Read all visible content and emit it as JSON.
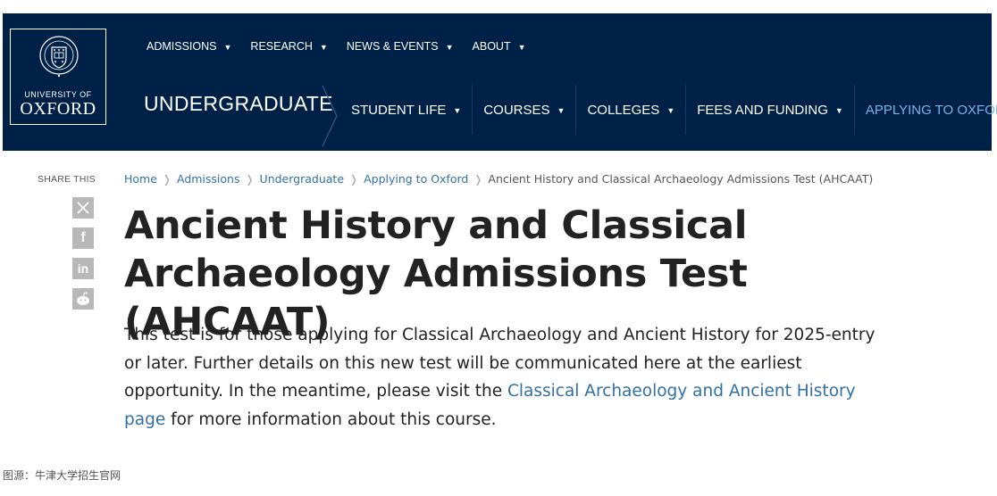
{
  "logo": {
    "line1": "UNIVERSITY OF",
    "line2": "OXFORD"
  },
  "top_nav": [
    {
      "label": "ADMISSIONS"
    },
    {
      "label": "RESEARCH"
    },
    {
      "label": "NEWS & EVENTS"
    },
    {
      "label": "ABOUT"
    }
  ],
  "section_title": "UNDERGRADUATE",
  "main_nav": [
    {
      "label": "STUDENT LIFE"
    },
    {
      "label": "COURSES"
    },
    {
      "label": "COLLEGES"
    },
    {
      "label": "FEES AND FUNDING"
    },
    {
      "label": "APPLYING TO OXFORD",
      "active": true
    }
  ],
  "share": {
    "label": "SHARE THIS",
    "icons": [
      "x-icon",
      "facebook-icon",
      "linkedin-icon",
      "reddit-icon"
    ]
  },
  "breadcrumb": [
    {
      "label": "Home"
    },
    {
      "label": "Admissions"
    },
    {
      "label": "Undergraduate"
    },
    {
      "label": "Applying to Oxford"
    },
    {
      "label": "Ancient History and Classical Archaeology Admissions Test (AHCAAT)"
    }
  ],
  "page": {
    "title": "Ancient History and Classical Archaeology Admissions Test (AHCAAT)",
    "body_before": "This test is for those applying for Classical Archaeology and Ancient History for 2025-entry or later. Further details on this new test will be communicated here at the earliest opportunity. In the meantime, please visit the ",
    "body_link": "Classical Archaeology and Ancient History page",
    "body_after": " for more information about this course."
  },
  "source_note": "图源：牛津大学招生官网",
  "colors": {
    "header_bg": "#002147",
    "link": "#3170a7",
    "active_nav": "#7ab4e8",
    "share_icon_bg": "#b8b8b8"
  }
}
